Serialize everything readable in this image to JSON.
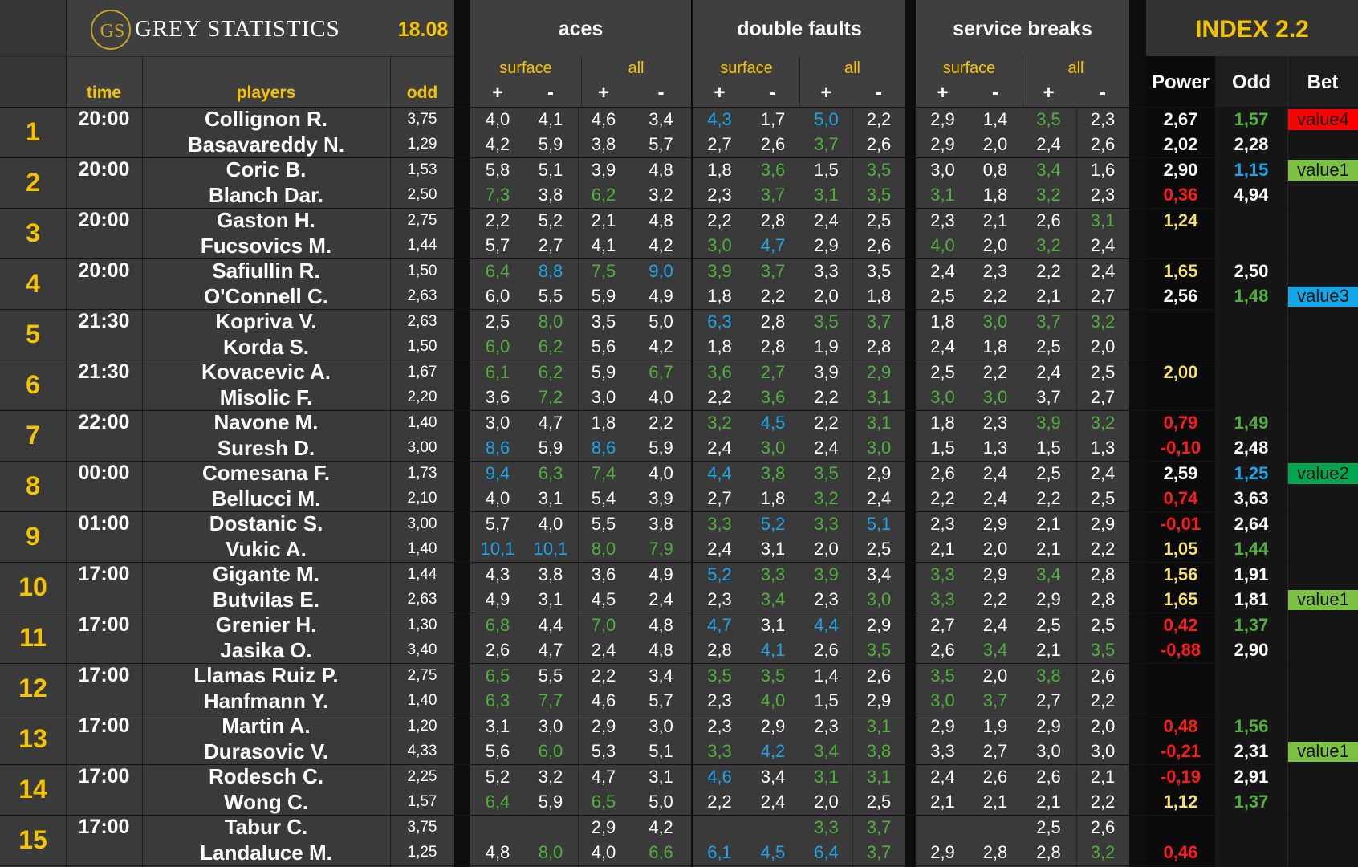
{
  "header": {
    "logo_mark": "GS",
    "brand": "GREY STATISTICS",
    "date": "18.08",
    "col_time": "time",
    "col_players": "players",
    "col_odd": "odd",
    "groups": [
      {
        "title": "aces",
        "sub1": "surface",
        "sub2": "all"
      },
      {
        "title": "double faults",
        "sub1": "surface",
        "sub2": "all"
      },
      {
        "title": "service breaks",
        "sub1": "surface",
        "sub2": "all"
      }
    ],
    "plus": "+",
    "minus": "-",
    "index_title": "INDEX 2.2",
    "col_power": "Power",
    "col_odd2": "Odd",
    "col_bet": "Bet"
  },
  "colors": {
    "white": "#ffffff",
    "green": "#4fae3c",
    "blue": "#1ba3e8",
    "red": "#ff1a1a",
    "yellow": "#f5e070",
    "gold": "#f5c400"
  },
  "badge_colors": {
    "value1": "#7dc142",
    "value2": "#00a650",
    "value3": "#12a7e8",
    "value4": "#ff0000"
  },
  "matches": [
    {
      "n": "1",
      "time": "20:00",
      "rows": [
        {
          "p": "Collignon R.",
          "o": "3,75",
          "s": [
            "4,0",
            "4,1",
            "4,6",
            "3,4",
            "4,3",
            "1,7",
            "5,0",
            "2,2",
            "2,9",
            "1,4",
            "3,5",
            "2,3"
          ],
          "c": "wwwwbwbwwwgw",
          "pw": "2,67",
          "pwc": "w",
          "od": "1,57",
          "odc": "g",
          "bet": "value4"
        },
        {
          "p": "Basavareddy N.",
          "o": "1,29",
          "s": [
            "4,2",
            "5,9",
            "3,8",
            "5,7",
            "2,7",
            "2,6",
            "3,7",
            "2,6",
            "2,9",
            "2,0",
            "2,4",
            "2,6"
          ],
          "c": "wwwwwwgwwwww",
          "pw": "2,02",
          "pwc": "w",
          "od": "2,28",
          "odc": "w",
          "bet": ""
        }
      ]
    },
    {
      "n": "2",
      "time": "20:00",
      "rows": [
        {
          "p": "Coric B.",
          "o": "1,53",
          "s": [
            "5,8",
            "5,1",
            "3,9",
            "4,8",
            "1,8",
            "3,6",
            "1,5",
            "3,5",
            "3,0",
            "0,8",
            "3,4",
            "1,6"
          ],
          "c": "wwwwwgwgwwgw",
          "pw": "2,90",
          "pwc": "w",
          "od": "1,15",
          "odc": "b",
          "bet": "value1"
        },
        {
          "p": "Blanch Dar.",
          "o": "2,50",
          "s": [
            "7,3",
            "3,8",
            "6,2",
            "3,2",
            "2,3",
            "3,7",
            "3,1",
            "3,5",
            "3,1",
            "1,8",
            "3,2",
            "2,3"
          ],
          "c": "gwgwwggggwgw",
          "pw": "0,36",
          "pwc": "r",
          "od": "4,94",
          "odc": "w",
          "bet": ""
        }
      ]
    },
    {
      "n": "3",
      "time": "20:00",
      "rows": [
        {
          "p": "Gaston H.",
          "o": "2,75",
          "s": [
            "2,2",
            "5,2",
            "2,1",
            "4,8",
            "2,2",
            "2,8",
            "2,4",
            "2,5",
            "2,3",
            "2,1",
            "2,6",
            "3,1"
          ],
          "c": "wwwwwwwwwwwg",
          "pw": "1,24",
          "pwc": "y",
          "od": "",
          "odc": "w",
          "bet": ""
        },
        {
          "p": "Fucsovics M.",
          "o": "1,44",
          "s": [
            "5,7",
            "2,7",
            "4,1",
            "4,2",
            "3,0",
            "4,7",
            "2,9",
            "2,6",
            "4,0",
            "2,0",
            "3,2",
            "2,4"
          ],
          "c": "wwwwgbwwgwgw",
          "pw": "",
          "pwc": "w",
          "od": "",
          "odc": "w",
          "bet": ""
        }
      ]
    },
    {
      "n": "4",
      "time": "20:00",
      "rows": [
        {
          "p": "Safiullin R.",
          "o": "1,50",
          "s": [
            "6,4",
            "8,8",
            "7,5",
            "9,0",
            "3,9",
            "3,7",
            "3,3",
            "3,5",
            "2,4",
            "2,3",
            "2,2",
            "2,4"
          ],
          "c": "gbgbggwwwwww",
          "pw": "1,65",
          "pwc": "y",
          "od": "2,50",
          "odc": "w",
          "bet": ""
        },
        {
          "p": "O'Connell C.",
          "o": "2,63",
          "s": [
            "6,0",
            "5,5",
            "5,9",
            "4,9",
            "1,8",
            "2,2",
            "2,0",
            "1,8",
            "2,5",
            "2,2",
            "2,1",
            "2,7"
          ],
          "c": "wwwwwwwwwwww",
          "pw": "2,56",
          "pwc": "w",
          "od": "1,48",
          "odc": "g",
          "bet": "value3"
        }
      ]
    },
    {
      "n": "5",
      "time": "21:30",
      "rows": [
        {
          "p": "Kopriva V.",
          "o": "2,63",
          "s": [
            "2,5",
            "8,0",
            "3,5",
            "5,0",
            "6,3",
            "2,8",
            "3,5",
            "3,7",
            "1,8",
            "3,0",
            "3,7",
            "3,2"
          ],
          "c": "wgwwbwggwggg",
          "pw": "",
          "pwc": "w",
          "od": "",
          "odc": "w",
          "bet": ""
        },
        {
          "p": "Korda S.",
          "o": "1,50",
          "s": [
            "6,0",
            "6,2",
            "5,6",
            "4,2",
            "1,8",
            "2,8",
            "1,9",
            "2,8",
            "2,4",
            "1,8",
            "2,5",
            "2,0"
          ],
          "c": "ggwwwwwwwwww",
          "pw": "",
          "pwc": "w",
          "od": "",
          "odc": "w",
          "bet": ""
        }
      ]
    },
    {
      "n": "6",
      "time": "21:30",
      "rows": [
        {
          "p": "Kovacevic A.",
          "o": "1,67",
          "s": [
            "6,1",
            "6,2",
            "5,9",
            "6,7",
            "3,6",
            "2,7",
            "3,9",
            "2,9",
            "2,5",
            "2,2",
            "2,4",
            "2,5"
          ],
          "c": "ggwgggwgwwww",
          "pw": "2,00",
          "pwc": "y",
          "od": "",
          "odc": "w",
          "bet": ""
        },
        {
          "p": "Misolic F.",
          "o": "2,20",
          "s": [
            "3,6",
            "7,2",
            "3,0",
            "4,0",
            "2,2",
            "3,6",
            "2,2",
            "3,1",
            "3,0",
            "3,0",
            "3,7",
            "2,7"
          ],
          "c": "wgwwwgwgggww",
          "pw": "",
          "pwc": "w",
          "od": "",
          "odc": "w",
          "bet": ""
        }
      ]
    },
    {
      "n": "7",
      "time": "22:00",
      "rows": [
        {
          "p": "Navone M.",
          "o": "1,40",
          "s": [
            "3,0",
            "4,7",
            "1,8",
            "2,2",
            "3,2",
            "4,5",
            "2,2",
            "3,1",
            "1,8",
            "2,3",
            "3,9",
            "3,2"
          ],
          "c": "wwwwgbwgwwgg",
          "pw": "0,79",
          "pwc": "r",
          "od": "1,49",
          "odc": "g",
          "bet": ""
        },
        {
          "p": "Suresh D.",
          "o": "3,00",
          "s": [
            "8,6",
            "5,9",
            "8,6",
            "5,9",
            "2,4",
            "3,0",
            "2,4",
            "3,0",
            "1,5",
            "1,3",
            "1,5",
            "1,3"
          ],
          "c": "bwbwwgwgwwww",
          "pw": "-0,10",
          "pwc": "r",
          "od": "2,48",
          "odc": "w",
          "bet": ""
        }
      ]
    },
    {
      "n": "8",
      "time": "00:00",
      "rows": [
        {
          "p": "Comesana F.",
          "o": "1,73",
          "s": [
            "9,4",
            "6,3",
            "7,4",
            "4,0",
            "4,4",
            "3,8",
            "3,5",
            "2,9",
            "2,6",
            "2,4",
            "2,5",
            "2,4"
          ],
          "c": "bggwbggwwwww",
          "pw": "2,59",
          "pwc": "w",
          "od": "1,25",
          "odc": "b",
          "bet": "value2"
        },
        {
          "p": "Bellucci M.",
          "o": "2,10",
          "s": [
            "4,0",
            "3,1",
            "5,4",
            "3,9",
            "2,7",
            "1,8",
            "3,2",
            "2,4",
            "2,2",
            "2,4",
            "2,2",
            "2,5"
          ],
          "c": "wwwwwwgwwwww",
          "pw": "0,74",
          "pwc": "r",
          "od": "3,63",
          "odc": "w",
          "bet": ""
        }
      ]
    },
    {
      "n": "9",
      "time": "01:00",
      "rows": [
        {
          "p": "Dostanic S.",
          "o": "3,00",
          "s": [
            "5,7",
            "4,0",
            "5,5",
            "3,8",
            "3,3",
            "5,2",
            "3,3",
            "5,1",
            "2,3",
            "2,9",
            "2,1",
            "2,9"
          ],
          "c": "wwwwgbgbwwww",
          "pw": "-0,01",
          "pwc": "r",
          "od": "2,64",
          "odc": "w",
          "bet": ""
        },
        {
          "p": "Vukic A.",
          "o": "1,40",
          "s": [
            "10,1",
            "10,1",
            "8,0",
            "7,9",
            "2,4",
            "3,1",
            "2,0",
            "2,5",
            "2,1",
            "2,0",
            "2,1",
            "2,2"
          ],
          "c": "bbggwwwwwwww",
          "pw": "1,05",
          "pwc": "y",
          "od": "1,44",
          "odc": "g",
          "bet": ""
        }
      ]
    },
    {
      "n": "10",
      "time": "17:00",
      "rows": [
        {
          "p": "Gigante M.",
          "o": "1,44",
          "s": [
            "4,3",
            "3,8",
            "3,6",
            "4,9",
            "5,2",
            "3,3",
            "3,9",
            "3,4",
            "3,3",
            "2,9",
            "3,4",
            "2,8"
          ],
          "c": "wwwwbggwgwgw",
          "pw": "1,56",
          "pwc": "y",
          "od": "1,91",
          "odc": "w",
          "bet": ""
        },
        {
          "p": "Butvilas E.",
          "o": "2,63",
          "s": [
            "4,9",
            "3,1",
            "4,5",
            "2,4",
            "2,3",
            "3,4",
            "2,3",
            "3,0",
            "3,3",
            "2,2",
            "2,9",
            "2,8"
          ],
          "c": "wwwwwgwggwww",
          "pw": "1,65",
          "pwc": "y",
          "od": "1,81",
          "odc": "w",
          "bet": "value1"
        }
      ]
    },
    {
      "n": "11",
      "time": "17:00",
      "rows": [
        {
          "p": "Grenier H.",
          "o": "1,30",
          "s": [
            "6,8",
            "4,4",
            "7,0",
            "4,8",
            "4,7",
            "3,1",
            "4,4",
            "2,9",
            "2,7",
            "2,4",
            "2,5",
            "2,5"
          ],
          "c": "gwgwbwbwwwww",
          "pw": "0,42",
          "pwc": "r",
          "od": "1,37",
          "odc": "g",
          "bet": ""
        },
        {
          "p": "Jasika O.",
          "o": "3,40",
          "s": [
            "2,6",
            "4,7",
            "2,4",
            "4,8",
            "2,8",
            "4,1",
            "2,6",
            "3,5",
            "2,6",
            "3,4",
            "2,1",
            "3,5"
          ],
          "c": "wwwwwbwgwgwg",
          "pw": "-0,88",
          "pwc": "r",
          "od": "2,90",
          "odc": "w",
          "bet": ""
        }
      ]
    },
    {
      "n": "12",
      "time": "17:00",
      "rows": [
        {
          "p": "Llamas Ruiz P.",
          "o": "2,75",
          "s": [
            "6,5",
            "5,5",
            "2,2",
            "3,4",
            "3,5",
            "3,5",
            "1,4",
            "2,6",
            "3,5",
            "2,0",
            "3,8",
            "2,6"
          ],
          "c": "gwwwggwwgwgw",
          "pw": "",
          "pwc": "w",
          "od": "",
          "odc": "w",
          "bet": ""
        },
        {
          "p": "Hanfmann Y.",
          "o": "1,40",
          "s": [
            "6,3",
            "7,7",
            "4,6",
            "5,7",
            "2,3",
            "4,0",
            "1,5",
            "2,9",
            "3,0",
            "3,7",
            "2,7",
            "2,2"
          ],
          "c": "ggwwwgwwggww",
          "pw": "",
          "pwc": "w",
          "od": "",
          "odc": "w",
          "bet": ""
        }
      ]
    },
    {
      "n": "13",
      "time": "17:00",
      "rows": [
        {
          "p": "Martin A.",
          "o": "1,20",
          "s": [
            "3,1",
            "3,0",
            "2,9",
            "3,0",
            "2,3",
            "2,9",
            "2,3",
            "3,1",
            "2,9",
            "1,9",
            "2,9",
            "2,0"
          ],
          "c": "wwwwwwwgwwww",
          "pw": "0,48",
          "pwc": "r",
          "od": "1,56",
          "odc": "g",
          "bet": ""
        },
        {
          "p": "Durasovic V.",
          "o": "4,33",
          "s": [
            "5,6",
            "6,0",
            "5,3",
            "5,1",
            "3,3",
            "4,2",
            "3,4",
            "3,8",
            "3,3",
            "2,7",
            "3,0",
            "3,0"
          ],
          "c": "wgwwgbggwwww",
          "pw": "-0,21",
          "pwc": "r",
          "od": "2,31",
          "odc": "w",
          "bet": "value1"
        }
      ]
    },
    {
      "n": "14",
      "time": "17:00",
      "rows": [
        {
          "p": "Rodesch C.",
          "o": "2,25",
          "s": [
            "5,2",
            "3,2",
            "4,7",
            "3,1",
            "4,6",
            "3,4",
            "3,1",
            "3,1",
            "2,4",
            "2,6",
            "2,6",
            "2,1"
          ],
          "c": "wwwwbwggwwww",
          "pw": "-0,19",
          "pwc": "r",
          "od": "2,91",
          "odc": "w",
          "bet": ""
        },
        {
          "p": "Wong C.",
          "o": "1,57",
          "s": [
            "6,4",
            "5,9",
            "6,5",
            "5,0",
            "2,2",
            "2,4",
            "2,0",
            "2,5",
            "2,1",
            "2,1",
            "2,1",
            "2,2"
          ],
          "c": "gwgwwwwwwwww",
          "pw": "1,12",
          "pwc": "y",
          "od": "1,37",
          "odc": "g",
          "bet": ""
        }
      ]
    },
    {
      "n": "15",
      "time": "17:00",
      "rows": [
        {
          "p": "Tabur C.",
          "o": "3,75",
          "s": [
            "",
            "",
            "2,9",
            "4,2",
            "",
            "",
            "3,3",
            "3,7",
            "",
            "",
            "2,5",
            "2,6"
          ],
          "c": "wwwwwwggwwww",
          "pw": "",
          "pwc": "w",
          "od": "",
          "odc": "w",
          "bet": ""
        },
        {
          "p": "Landaluce M.",
          "o": "1,25",
          "s": [
            "4,8",
            "8,0",
            "4,0",
            "6,6",
            "6,1",
            "4,5",
            "6,4",
            "3,7",
            "2,9",
            "2,8",
            "2,8",
            "3,2"
          ],
          "c": "wgwgbbbgwwwg",
          "pw": "0,46",
          "pwc": "r",
          "od": "",
          "odc": "w",
          "bet": ""
        }
      ]
    }
  ]
}
